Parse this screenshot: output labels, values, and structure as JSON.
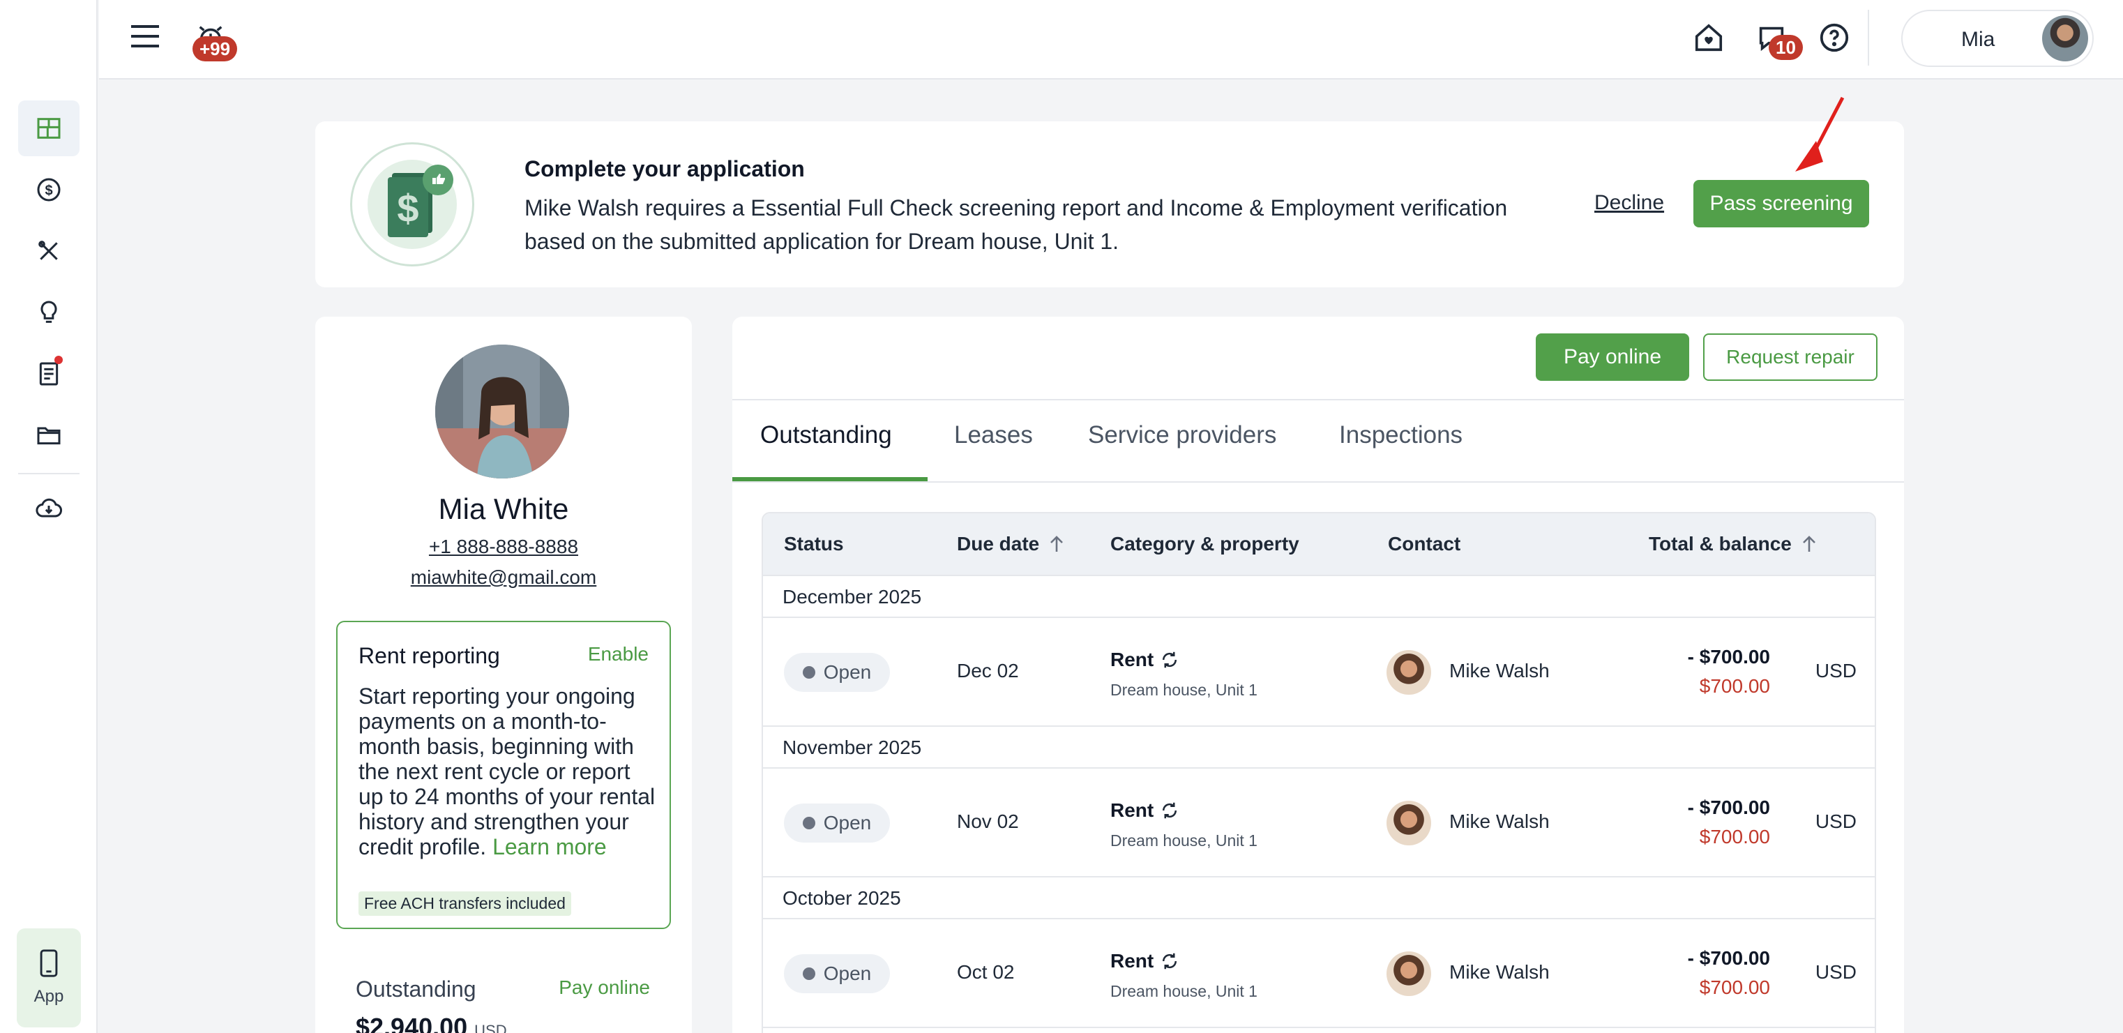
{
  "topbar": {
    "notifications_count": "+99",
    "messages_count": "10",
    "user_name": "Mia"
  },
  "sidebar": {
    "items": [
      "dashboard-icon",
      "payments-icon",
      "maintenance-icon",
      "insights-icon",
      "documents-icon",
      "files-icon",
      "download-icon"
    ],
    "app_label": "App"
  },
  "banner": {
    "title": "Complete your application",
    "text": "Mike Walsh requires a Essential Full Check screening report and Income & Employment verification based on the submitted application for Dream house, Unit 1.",
    "decline": "Decline",
    "pass": "Pass screening"
  },
  "profile": {
    "name": "Mia White",
    "phone": "+1 888-888-8888",
    "email": "miawhite@gmail.com",
    "rent_reporting": {
      "title": "Rent reporting",
      "enable": "Enable",
      "text": "Start reporting your ongoing payments on a month-to-month basis, beginning with the next rent cycle or report up to 24 months of your rental history and strengthen your credit profile.",
      "learn_more": "Learn more",
      "chip": "Free ACH transfers included"
    },
    "outstanding": {
      "title": "Outstanding",
      "pay": "Pay online",
      "amount": "$2,940.00",
      "currency": "USD"
    }
  },
  "actions": {
    "pay_online": "Pay online",
    "request_repair": "Request repair"
  },
  "tabs": [
    "Outstanding",
    "Leases",
    "Service providers",
    "Inspections"
  ],
  "table": {
    "headers": {
      "status": "Status",
      "due": "Due date",
      "category": "Category & property",
      "contact": "Contact",
      "total": "Total & balance"
    },
    "groups": [
      {
        "month": "December 2025",
        "status": "Open",
        "due": "Dec 02",
        "category": "Rent",
        "property": "Dream house, Unit 1",
        "contact": "Mike Walsh",
        "total": "- $700.00",
        "balance": "$700.00",
        "currency": "USD"
      },
      {
        "month": "November 2025",
        "status": "Open",
        "due": "Nov 02",
        "category": "Rent",
        "property": "Dream house, Unit 1",
        "contact": "Mike Walsh",
        "total": "- $700.00",
        "balance": "$700.00",
        "currency": "USD"
      },
      {
        "month": "October 2025",
        "status": "Open",
        "due": "Oct 02",
        "category": "Rent",
        "property": "Dream house, Unit 1",
        "contact": "Mike Walsh",
        "total": "- $700.00",
        "balance": "$700.00",
        "currency": "USD"
      }
    ]
  },
  "colors": {
    "accent": "#52a04a",
    "danger": "#c0392b"
  }
}
